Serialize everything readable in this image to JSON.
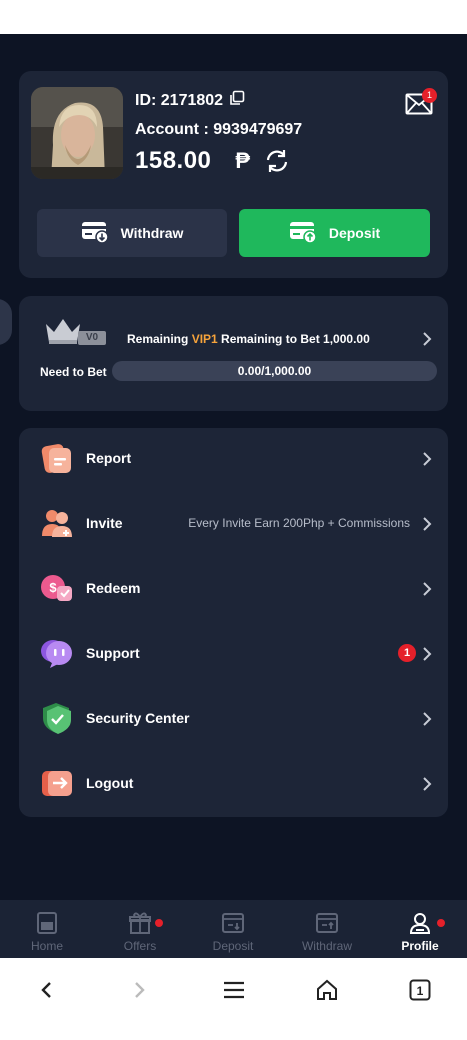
{
  "profile": {
    "id_text": "ID: 2171802",
    "account_text": "Account : 9939479697",
    "balance": "158.00",
    "currency_symbol": "₱",
    "mail_badge": "1",
    "withdraw_label": "Withdraw",
    "deposit_label": "Deposit"
  },
  "vip": {
    "level_badge": "V0",
    "remaining_prefix": "Remaining",
    "next_level": "VIP1",
    "remaining_suffix": "Remaining to Bet 1,000.00",
    "need_label": "Need to Bet",
    "progress_text": "0.00/1,000.00",
    "progress_fraction": 0
  },
  "menu": {
    "items": [
      {
        "label": "Report",
        "icon": "report-icon"
      },
      {
        "label": "Invite",
        "icon": "invite-icon",
        "note": "Every Invite Earn 200Php + Commissions"
      },
      {
        "label": "Redeem",
        "icon": "redeem-icon"
      },
      {
        "label": "Support",
        "icon": "support-icon",
        "badge": "1"
      },
      {
        "label": "Security Center",
        "icon": "shield-icon"
      },
      {
        "label": "Logout",
        "icon": "logout-icon"
      }
    ]
  },
  "nav": {
    "items": [
      {
        "label": "Home",
        "icon": "home-icon"
      },
      {
        "label": "Offers",
        "icon": "gift-icon"
      },
      {
        "label": "Deposit",
        "icon": "deposit-icon"
      },
      {
        "label": "Withdraw",
        "icon": "withdraw-icon"
      },
      {
        "label": "Profile",
        "icon": "profile-icon"
      }
    ],
    "active": "Profile"
  },
  "system_nav": {
    "tabs_count": "1"
  },
  "colors": {
    "background": "#0d1424",
    "card": "#1d2537",
    "deposit_green": "#1fb85c",
    "vip_accent": "#f6a33b",
    "badge_red": "#e5202a"
  }
}
